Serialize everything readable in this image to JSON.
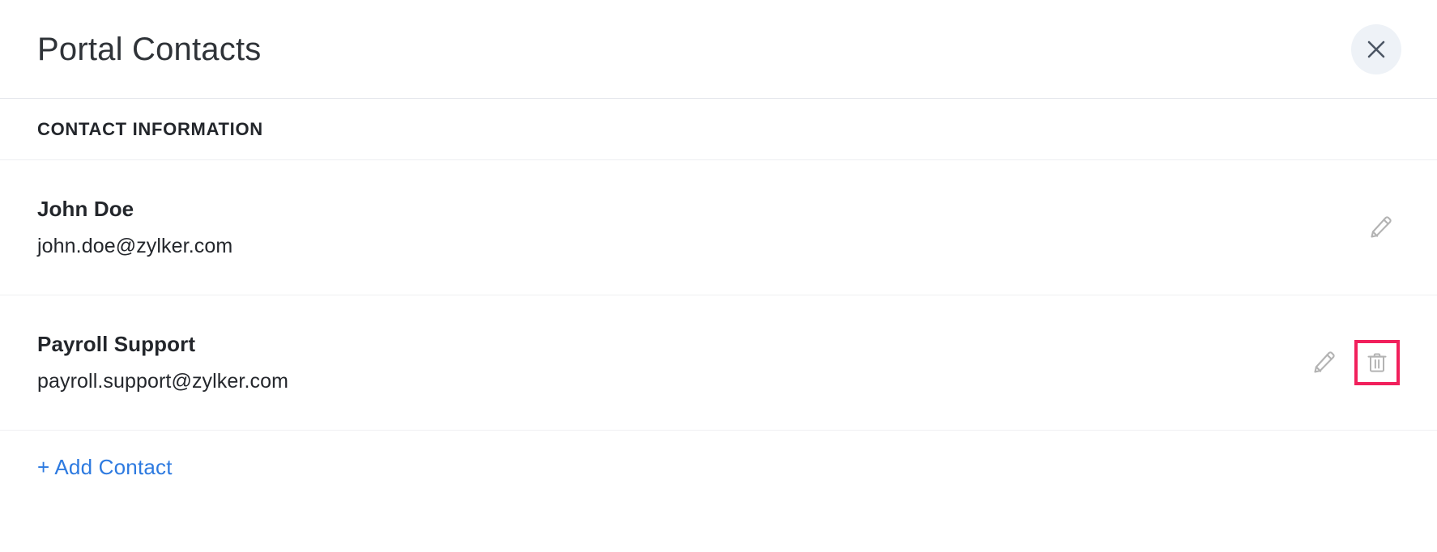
{
  "header": {
    "title": "Portal Contacts",
    "close_icon": "close-icon"
  },
  "section": {
    "label": "CONTACT INFORMATION"
  },
  "contacts": [
    {
      "name": "John Doe",
      "email": "john.doe@zylker.com",
      "actions": [
        "edit"
      ]
    },
    {
      "name": "Payroll Support",
      "email": "payroll.support@zylker.com",
      "actions": [
        "edit",
        "delete"
      ]
    }
  ],
  "footer": {
    "add_contact_label": "+ Add Contact"
  },
  "icons": {
    "edit": "pencil-icon",
    "delete": "trash-icon",
    "close": "close-icon"
  },
  "colors": {
    "link": "#2d7ae0",
    "highlight_border": "#f1205c",
    "icon_gray": "#b3b3b3",
    "close_bg": "#eef2f7",
    "close_glyph": "#4c5664",
    "divider": "#eff0f2",
    "text_primary": "#23262b"
  }
}
